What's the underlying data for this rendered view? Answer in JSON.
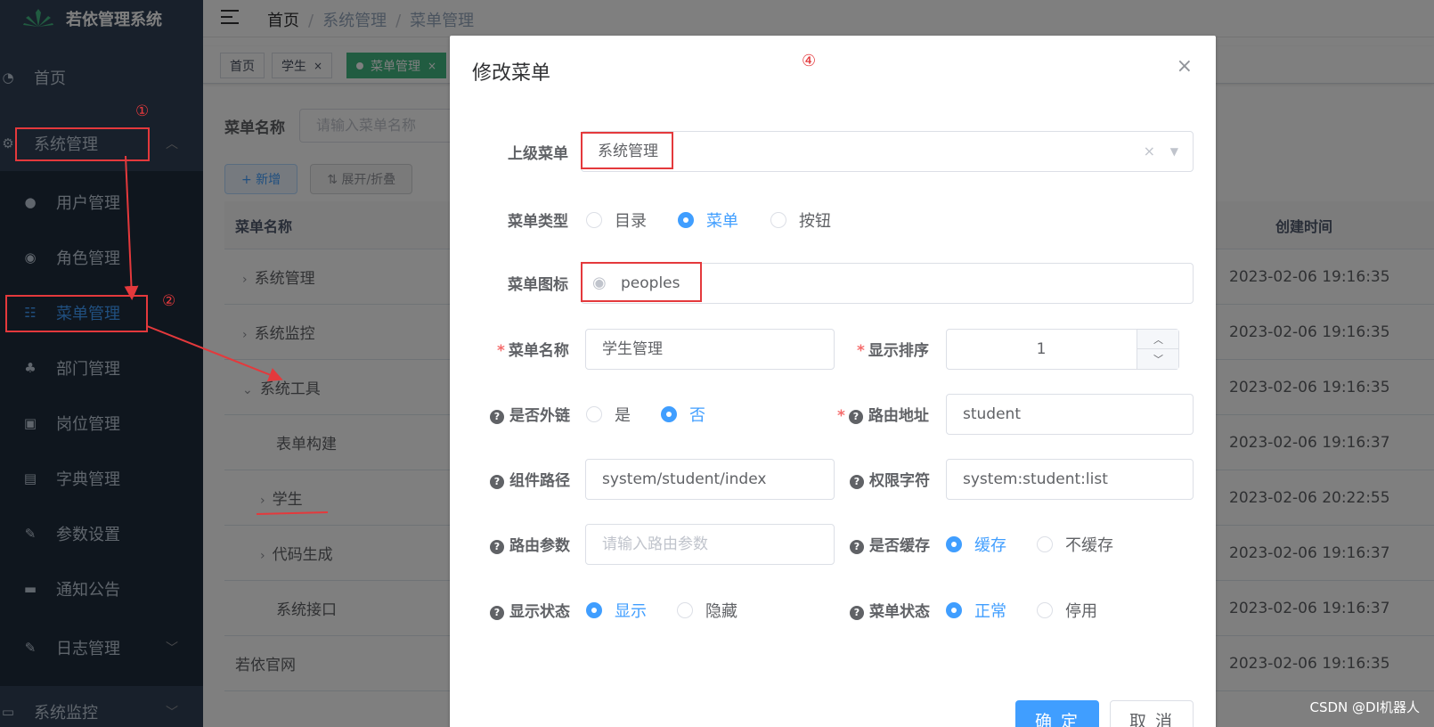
{
  "app": {
    "title": "若依管理系统"
  },
  "sidebar": {
    "home": "首页",
    "system": "系统管理",
    "items": [
      "用户管理",
      "角色管理",
      "菜单管理",
      "部门管理",
      "岗位管理",
      "字典管理",
      "参数设置",
      "通知公告",
      "日志管理"
    ],
    "monitor": "系统监控"
  },
  "breadcrumb": {
    "home": "首页",
    "section": "系统管理",
    "current": "菜单管理"
  },
  "tags": {
    "home": "首页",
    "student": "学生",
    "menu": "菜单管理",
    "close": "×"
  },
  "search": {
    "label": "菜单名称",
    "placeholder": "请输入菜单名称"
  },
  "toolbar": {
    "add": "+ 新增",
    "toggle": "⇅ 展开/折叠"
  },
  "table": {
    "headers": {
      "name": "菜单名称",
      "time": "创建时间"
    },
    "rows": [
      {
        "name": "系统管理",
        "time": "2023-02-06 19:16:35"
      },
      {
        "name": "系统监控",
        "time": "2023-02-06 19:16:35"
      },
      {
        "name": "系统工具",
        "time": "2023-02-06 19:16:35"
      },
      {
        "name": "表单构建",
        "time": "2023-02-06 19:16:37"
      },
      {
        "name": "学生",
        "time": "2023-02-06 20:22:55"
      },
      {
        "name": "代码生成",
        "time": "2023-02-06 19:16:37"
      },
      {
        "name": "系统接口",
        "time": "2023-02-06 19:16:37"
      },
      {
        "name": "若依官网",
        "time": "2023-02-06 19:16:35"
      }
    ]
  },
  "dialog": {
    "title": "修改菜单",
    "close": "×",
    "parent": {
      "label": "上级菜单",
      "value": "系统管理"
    },
    "type": {
      "label": "菜单类型",
      "options": [
        "目录",
        "菜单",
        "按钮"
      ],
      "selected": "菜单"
    },
    "icon": {
      "label": "菜单图标",
      "value": "peoples"
    },
    "name": {
      "label": "菜单名称",
      "value": "学生管理"
    },
    "order": {
      "label": "显示排序",
      "value": "1"
    },
    "external": {
      "label": "是否外链",
      "options": [
        "是",
        "否"
      ],
      "selected": "否"
    },
    "route": {
      "label": "路由地址",
      "value": "student"
    },
    "component": {
      "label": "组件路径",
      "value": "system/student/index"
    },
    "perms": {
      "label": "权限字符",
      "value": "system:student:list"
    },
    "query": {
      "label": "路由参数",
      "placeholder": "请输入路由参数"
    },
    "cache": {
      "label": "是否缓存",
      "options": [
        "缓存",
        "不缓存"
      ],
      "selected": "缓存"
    },
    "visible": {
      "label": "显示状态",
      "options": [
        "显示",
        "隐藏"
      ],
      "selected": "显示"
    },
    "status": {
      "label": "菜单状态",
      "options": [
        "正常",
        "停用"
      ],
      "selected": "正常"
    },
    "confirm": "确 定",
    "cancel": "取 消"
  },
  "annotations": {
    "a1": "①",
    "a2": "②",
    "a4": "④"
  },
  "watermark": "CSDN @DI机器人",
  "colors": {
    "primary": "#409eff",
    "sidebar": "#304156",
    "annotation": "#e4393c"
  }
}
